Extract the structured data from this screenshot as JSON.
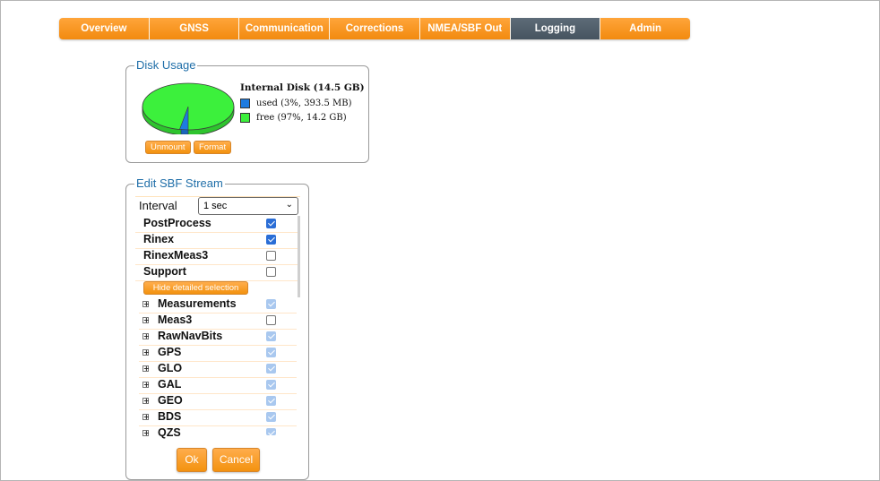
{
  "nav": {
    "tabs": [
      {
        "label": "Overview",
        "active": false
      },
      {
        "label": "GNSS",
        "active": false
      },
      {
        "label": "Communication",
        "active": false
      },
      {
        "label": "Corrections",
        "active": false
      },
      {
        "label": "NMEA/SBF Out",
        "active": false
      },
      {
        "label": "Logging",
        "active": true
      },
      {
        "label": "Admin",
        "active": false
      }
    ]
  },
  "colors": {
    "accent_orange": "#f7931e",
    "active_tab": "#4f5d69",
    "legend_blue": "#1f6ea8",
    "used_color": "#1e7be0",
    "free_color": "#3cf03c"
  },
  "disk_usage": {
    "legend": "Disk Usage",
    "title": "Internal Disk (14.5 GB)",
    "used_label": "used (3%, 393.5 MB)",
    "free_label": "free (97%, 14.2 GB)",
    "used_percent": 3,
    "free_percent": 97,
    "unmount_label": "Unmount",
    "format_label": "Format"
  },
  "sbf_stream": {
    "legend": "Edit SBF Stream",
    "interval_label": "Interval",
    "interval_value": "1 sec",
    "groups": [
      {
        "label": "PostProcess",
        "checked": true
      },
      {
        "label": "Rinex",
        "checked": true
      },
      {
        "label": "RinexMeas3",
        "checked": false
      },
      {
        "label": "Support",
        "checked": false
      }
    ],
    "hide_button": "Hide detailed selection",
    "details": [
      {
        "label": "Measurements",
        "state": "dim"
      },
      {
        "label": "Meas3",
        "state": "off"
      },
      {
        "label": "RawNavBits",
        "state": "dim"
      },
      {
        "label": "GPS",
        "state": "dim"
      },
      {
        "label": "GLO",
        "state": "dim"
      },
      {
        "label": "GAL",
        "state": "dim"
      },
      {
        "label": "GEO",
        "state": "dim"
      },
      {
        "label": "BDS",
        "state": "dim"
      },
      {
        "label": "QZS",
        "state": "dim"
      }
    ],
    "ok_label": "Ok",
    "cancel_label": "Cancel"
  }
}
